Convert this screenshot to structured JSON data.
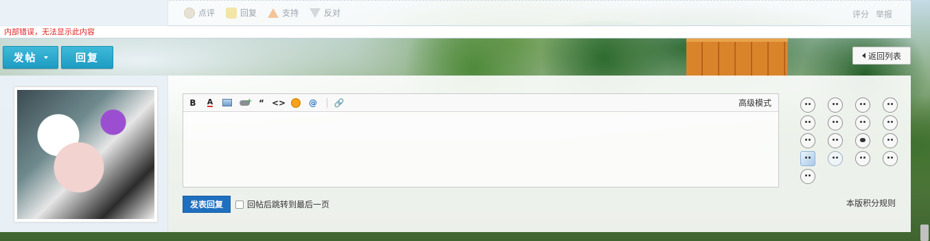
{
  "post_actions": {
    "comment": "点评",
    "reply": "回复",
    "support": "支持",
    "oppose": "反对",
    "rate": "评分",
    "report": "举报"
  },
  "error_message": "内部错误，无法显示此内容",
  "buttons": {
    "new_post": "发帖",
    "reply": "回复",
    "back_to_list": "返回列表"
  },
  "editor": {
    "toolbar": [
      {
        "name": "bold-icon",
        "glyph": "B"
      },
      {
        "name": "font-color-icon",
        "glyph": "A"
      },
      {
        "name": "image-icon",
        "glyph": ""
      },
      {
        "name": "insert-link-icon",
        "glyph": ""
      },
      {
        "name": "quote-icon",
        "glyph": "“"
      },
      {
        "name": "code-icon",
        "glyph": "<>"
      },
      {
        "name": "smiley-icon",
        "glyph": ""
      },
      {
        "name": "mention-icon",
        "glyph": "@"
      },
      {
        "name": "attachment-icon",
        "glyph": "🔗"
      }
    ],
    "advanced_mode": "高级模式",
    "submit": "发表回复",
    "jump_checkbox_label": "回帖后跳转到最后一页",
    "jump_checked": false
  },
  "rules_link": "本版积分规则",
  "smilies": [
    "face",
    "face",
    "face",
    "face",
    "face",
    "face",
    "face",
    "face",
    "face",
    "face",
    "dark",
    "face",
    "ice",
    "crown",
    "face",
    "face",
    "face"
  ],
  "colors": {
    "primary_button": "#1f9ec4",
    "submit_button": "#1f6fbf",
    "error_text": "#e02020"
  }
}
